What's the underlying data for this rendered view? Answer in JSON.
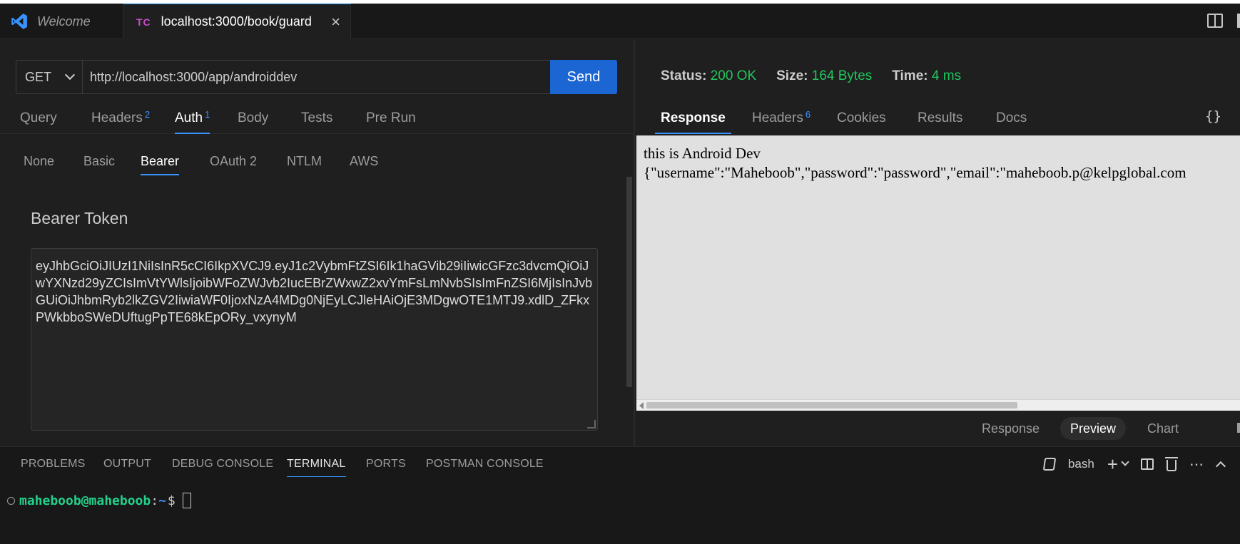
{
  "tabs": {
    "welcome": "Welcome",
    "active_badge": "TC",
    "active_title": "localhost:3000/book/guard",
    "close": "×"
  },
  "request": {
    "method": "GET",
    "url": "http://localhost:3000/app/androiddev",
    "send_label": "Send",
    "tabs": [
      {
        "label": "Query",
        "count": ""
      },
      {
        "label": "Headers",
        "count": "2"
      },
      {
        "label": "Auth",
        "count": "1"
      },
      {
        "label": "Body",
        "count": ""
      },
      {
        "label": "Tests",
        "count": ""
      },
      {
        "label": "Pre Run",
        "count": ""
      }
    ],
    "auth_tabs": [
      "None",
      "Basic",
      "Bearer",
      "OAuth 2",
      "NTLM",
      "AWS"
    ],
    "bearer_label": "Bearer Token",
    "token": "eyJhbGciOiJIUzI1NiIsInR5cCI6IkpXVCJ9.eyJ1c2VybmFtZSI6Ik1haGVib29iIiwicGFzc3dvcmQiOiJwYXNzd29yZCIsImVtYWlsIjoibWFoZWJvb2IucEBrZWxwZ2xvYmFsLmNvbSIsImFnZSI6MjIsInJvbGUiOiJhbmRyb2lkZGV2IiwiaWF0IjoxNzA4MDg0NjEyLCJleHAiOjE3MDgwOTE1MTJ9.xdlD_ZFkxPWkbboSWeDUftugPpTE68kEpORy_vxynyM"
  },
  "response": {
    "status_label": "Status:",
    "status_value": "200 OK",
    "size_label": "Size:",
    "size_value": "164 Bytes",
    "time_label": "Time:",
    "time_value": "4 ms",
    "tabs": [
      {
        "label": "Response",
        "count": ""
      },
      {
        "label": "Headers",
        "count": "6"
      },
      {
        "label": "Cookies",
        "count": ""
      },
      {
        "label": "Results",
        "count": ""
      },
      {
        "label": "Docs",
        "count": ""
      }
    ],
    "braces": "{}",
    "preview_line1": "this is Android Dev",
    "preview_line2": "{\"username\":\"Maheboob\",\"password\":\"password\",\"email\":\"maheboob.p@kelpglobal.com",
    "view_tabs": [
      "Response",
      "Preview",
      "Chart"
    ]
  },
  "panel": {
    "tabs": [
      "PROBLEMS",
      "OUTPUT",
      "DEBUG CONSOLE",
      "TERMINAL",
      "PORTS",
      "POSTMAN CONSOLE"
    ],
    "shell": "bash",
    "prompt_user": "maheboob@maheboob",
    "prompt_colon": ":",
    "prompt_path": "~",
    "prompt_symbol": "$"
  },
  "colors": {
    "accent": "#3794ff",
    "send_button": "#1c66d4",
    "status_ok": "#22c55e"
  }
}
